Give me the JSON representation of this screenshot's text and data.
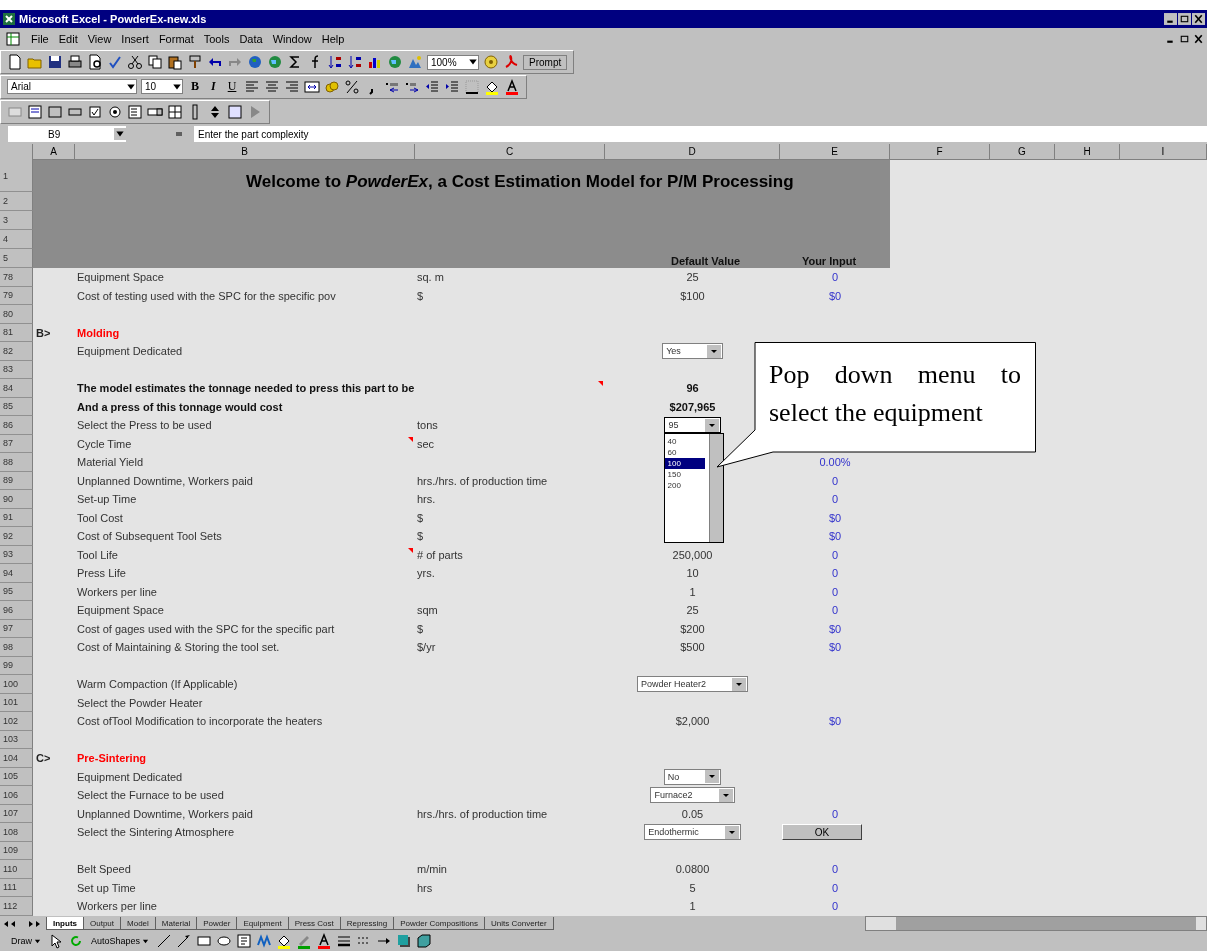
{
  "window": {
    "title": "Microsoft Excel - PowderEx-new.xls"
  },
  "menu": [
    "File",
    "Edit",
    "View",
    "Insert",
    "Format",
    "Tools",
    "Data",
    "Window",
    "Help"
  ],
  "toolbar": {
    "zoom": "100%",
    "prompt": "Prompt"
  },
  "formatting": {
    "font": "Arial",
    "size": "10",
    "buttons": [
      "B",
      "I",
      "U"
    ]
  },
  "formula_bar": {
    "name_box": "B9",
    "formula": "Enter the part complexity"
  },
  "columns": [
    "A",
    "B",
    "C",
    "D",
    "E",
    "F",
    "G",
    "H",
    "I"
  ],
  "header": {
    "row_numbers": [
      "1",
      "2",
      "3",
      "4",
      "5"
    ],
    "title": "Welcome to *PowderEx*, a Cost Estimation Model for P/M Processing",
    "default_heading": "Default Value",
    "input_heading": "Your Input"
  },
  "rows": [
    {
      "num": "78",
      "kind": "normal",
      "label": "Equipment Space",
      "unit": "sq. m",
      "default": "25",
      "input": "0"
    },
    {
      "num": "79",
      "kind": "normal",
      "label": "Cost of testing used with the SPC for the specific pov",
      "unit": "$",
      "default": "$100",
      "input": "$0"
    },
    {
      "num": "80"
    },
    {
      "num": "81",
      "kind": "section",
      "marker": "B>",
      "label": "Molding"
    },
    {
      "num": "82",
      "kind": "normal",
      "label": "Equipment Dedicated",
      "dropdown": {
        "value": "Yes",
        "expanded": false
      }
    },
    {
      "num": "83"
    },
    {
      "num": "84",
      "kind": "bold",
      "label": "The model estimates the tonnage needed to press this part to be",
      "unit_note": true,
      "default": "96"
    },
    {
      "num": "85",
      "kind": "bold",
      "label": " And a press of this tonnage would cost",
      "default": "$207,965"
    },
    {
      "num": "86",
      "kind": "normal",
      "label": "Select the Press to be used",
      "unit": "tons",
      "dropdown": {
        "value": "95",
        "expanded": true,
        "options": [
          {
            "label": "40",
            "selected": false
          },
          {
            "label": "60",
            "selected": false
          },
          {
            "label": "100",
            "selected": true
          },
          {
            "label": "150",
            "selected": false
          },
          {
            "label": "200",
            "selected": false
          }
        ]
      }
    },
    {
      "num": "87",
      "kind": "normal",
      "label": "Cycle Time",
      "label_note": true,
      "unit": "sec"
    },
    {
      "num": "88",
      "kind": "normal",
      "label": "Material Yield",
      "input": "0.00%"
    },
    {
      "num": "89",
      "kind": "normal",
      "label": "Unplanned Downtime, Workers paid",
      "unit": "hrs./hrs. of production time",
      "input": "0"
    },
    {
      "num": "90",
      "kind": "normal",
      "label": "Set-up Time",
      "unit": "hrs.",
      "input": "0"
    },
    {
      "num": "91",
      "kind": "normal",
      "label": "Tool Cost",
      "unit": "$",
      "input": "$0"
    },
    {
      "num": "92",
      "kind": "normal",
      "label": "Cost of Subsequent Tool Sets",
      "unit": "$",
      "input": "$0"
    },
    {
      "num": "93",
      "kind": "normal",
      "label": "Tool Life",
      "label_note": true,
      "unit": "# of parts",
      "default": "250,000",
      "input": "0"
    },
    {
      "num": "94",
      "kind": "normal",
      "label": "Press Life",
      "unit": "yrs.",
      "default": "10",
      "input": "0"
    },
    {
      "num": "95",
      "kind": "normal",
      "label": "Workers per line",
      "default": "1",
      "input": "0"
    },
    {
      "num": "96",
      "kind": "normal",
      "label": "Equipment Space",
      "unit": "sqm",
      "default": "25",
      "input": "0"
    },
    {
      "num": "97",
      "kind": "normal",
      "label": "Cost of gages used with the SPC for the specific part",
      "unit": "$",
      "default": "$200",
      "input": "$0"
    },
    {
      "num": "98",
      "kind": "normal",
      "label": "Cost of Maintaining & Storing the tool set.",
      "unit": "$/yr",
      "default": "$500",
      "input": "$0"
    },
    {
      "num": "99"
    },
    {
      "num": "100",
      "kind": "normal",
      "label": "Warm Compaction (If Applicable)",
      "dropdown": {
        "value": "Powder Heater2",
        "expanded": false
      }
    },
    {
      "num": "101",
      "kind": "normal",
      "label": "Select the Powder Heater"
    },
    {
      "num": "102",
      "kind": "normal",
      "label": "Cost ofTool Modification to incorporate the heaters",
      "default": "$2,000",
      "input": "$0"
    },
    {
      "num": "103"
    },
    {
      "num": "104",
      "kind": "section",
      "marker": "C>",
      "label": "Pre-Sintering"
    },
    {
      "num": "105",
      "kind": "normal",
      "label": "Equipment Dedicated",
      "dropdown": {
        "value": "No",
        "expanded": false
      }
    },
    {
      "num": "106",
      "kind": "normal",
      "label": "Select the Furnace to be used",
      "dropdown": {
        "value": "Furnace2",
        "expanded": false
      }
    },
    {
      "num": "107",
      "kind": "normal",
      "label": "Unplanned Downtime, Workers paid",
      "unit": "hrs./hrs. of production time",
      "default": "0.05",
      "input": "0"
    },
    {
      "num": "108",
      "kind": "normal",
      "label": "Select the Sintering Atmosphere",
      "dropdown": {
        "value": "Endothermic",
        "expanded": false
      },
      "button": "OK"
    },
    {
      "num": "109"
    },
    {
      "num": "110",
      "kind": "normal",
      "label": "Belt Speed",
      "unit": "m/min",
      "default": "0.0800",
      "input": "0"
    },
    {
      "num": "111",
      "kind": "normal",
      "label": "Set up Time",
      "unit": "hrs",
      "default": "5",
      "input": "0"
    },
    {
      "num": "112",
      "kind": "normal",
      "label": "Workers per line",
      "default": "1",
      "input": "0"
    }
  ],
  "callout": {
    "text": "Pop down menu to select the equipment"
  },
  "sheet_tabs": [
    {
      "label": "Inputs",
      "selected": true
    },
    {
      "label": "Output",
      "selected": false
    },
    {
      "label": "Model",
      "selected": false
    },
    {
      "label": "Material",
      "selected": false
    },
    {
      "label": "Powder",
      "selected": false
    },
    {
      "label": "Equipment",
      "selected": false
    },
    {
      "label": "Press Cost",
      "selected": false
    },
    {
      "label": "Repressing",
      "selected": false
    },
    {
      "label": "Powder Compositions",
      "selected": false
    },
    {
      "label": "Units Converter",
      "selected": false
    }
  ],
  "draw_toolbar": {
    "draw": "Draw",
    "autoshapes": "AutoShapes"
  }
}
